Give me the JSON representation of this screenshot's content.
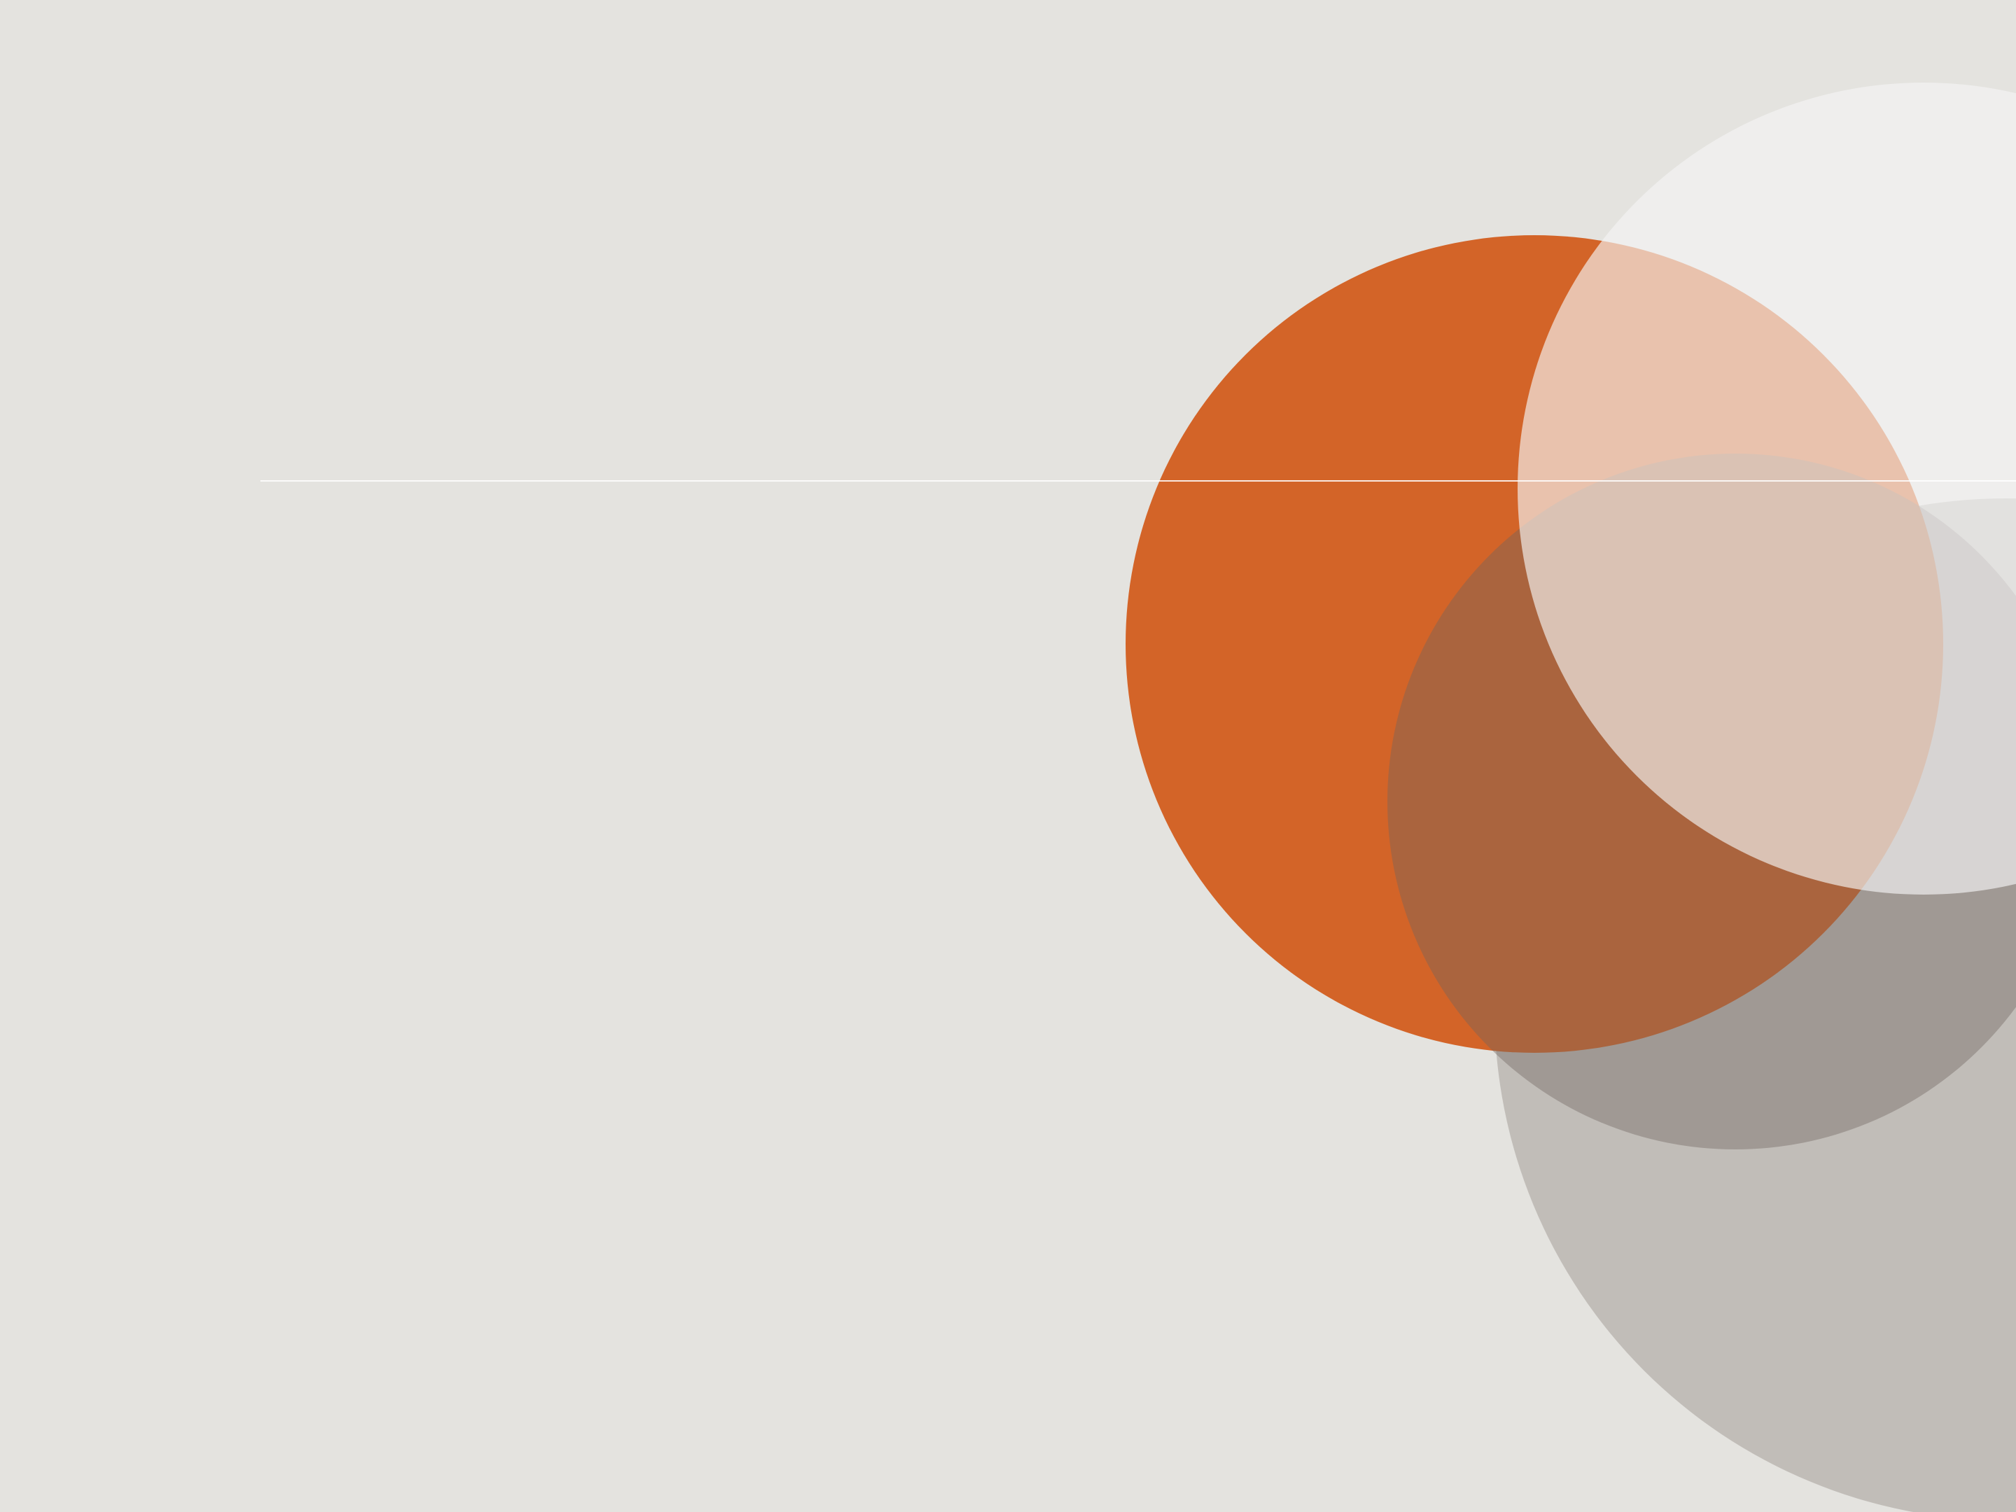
{
  "palette": {
    "background": "#e4e3df",
    "orange": "#d36428",
    "large_gray": "#bbb6b1",
    "dark_overlay": "#6e655f",
    "light_top": "#f5f5f5",
    "rule": "#ffffff"
  },
  "shapes": [
    {
      "name": "large-gray-circle",
      "color_key": "large_gray"
    },
    {
      "name": "orange-circle",
      "color_key": "orange"
    },
    {
      "name": "dark-overlay-circle",
      "color_key": "dark_overlay"
    },
    {
      "name": "light-top-circle",
      "color_key": "light_top"
    }
  ]
}
